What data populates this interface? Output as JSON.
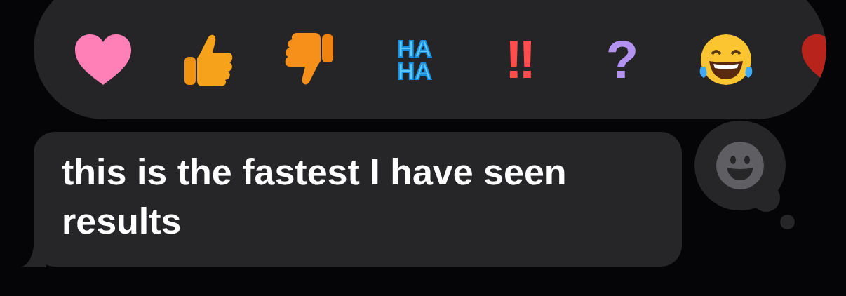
{
  "reactions": [
    {
      "kind": "heart",
      "color": "#ff80b6"
    },
    {
      "kind": "thumbs_up"
    },
    {
      "kind": "thumbs_down"
    },
    {
      "kind": "haha",
      "lines": [
        "HA",
        "HA"
      ]
    },
    {
      "kind": "exclaim",
      "text": "!!"
    },
    {
      "kind": "question",
      "text": "?"
    },
    {
      "kind": "laugh"
    },
    {
      "kind": "heart",
      "color": "#b8241c"
    }
  ],
  "message": {
    "text": "this is the fastest I have seen results"
  }
}
